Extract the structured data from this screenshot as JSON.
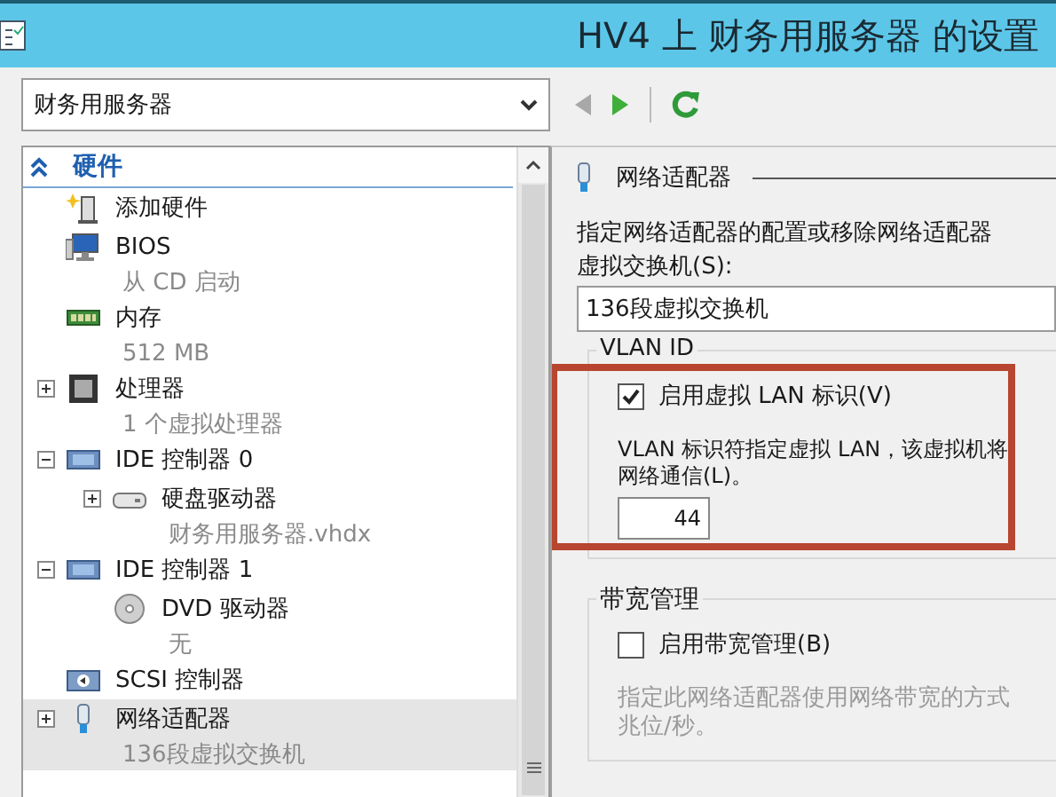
{
  "window": {
    "title": "HV4 上 财务用服务器 的设置"
  },
  "vm_selector": {
    "value": "财务用服务器"
  },
  "nav_buttons": [
    {
      "kind": "back",
      "disabled": true
    },
    {
      "kind": "forward",
      "disabled": false
    },
    {
      "kind": "refresh",
      "disabled": false
    }
  ],
  "tree": {
    "section": "硬件",
    "expanded": true,
    "items": [
      {
        "kind": "add-hardware",
        "label": "添加硬件",
        "selected": false
      },
      {
        "kind": "bios",
        "label": "BIOS",
        "detail": "从 CD 启动",
        "selected": false
      },
      {
        "kind": "memory",
        "label": "内存",
        "detail": "512 MB",
        "selected": false
      },
      {
        "kind": "cpu",
        "label": "处理器",
        "detail": "1 个虚拟处理器",
        "expanded": false,
        "selected": false
      },
      {
        "kind": "ide",
        "label": "IDE 控制器 0",
        "expanded": true,
        "selected": false,
        "children": [
          {
            "kind": "disk",
            "label": "硬盘驱动器",
            "detail": "财务用服务器.vhdx",
            "expanded": false,
            "selected": false
          }
        ]
      },
      {
        "kind": "ide",
        "label": "IDE 控制器 1",
        "expanded": true,
        "selected": false,
        "children": [
          {
            "kind": "dvd",
            "label": "DVD 驱动器",
            "detail": "无",
            "selected": false
          }
        ]
      },
      {
        "kind": "scsi",
        "label": "SCSI 控制器",
        "selected": false
      },
      {
        "kind": "network",
        "label": "网络适配器",
        "detail": "136段虚拟交换机",
        "expanded": false,
        "selected": true
      }
    ]
  },
  "panel": {
    "title": "网络适配器",
    "description": "指定网络适配器的配置或移除网络适配器",
    "switch_label": "虚拟交换机(S):",
    "switch_value": "136段虚拟交换机",
    "vlan": {
      "title": "VLAN ID",
      "highlighted": true,
      "checkbox": {
        "label": "启用虚拟 LAN 标识(V)",
        "checked": true
      },
      "help_lines": [
        "VLAN 标识符指定虚拟 LAN，该虚拟机将",
        "网络通信(L)。"
      ],
      "value": "44"
    },
    "bandwidth": {
      "title": "带宽管理",
      "checkbox": {
        "label": "启用带宽管理(B)",
        "checked": false
      },
      "help_lines": [
        "指定此网络适配器使用网络带宽的方式",
        "兆位/秒。"
      ]
    }
  }
}
